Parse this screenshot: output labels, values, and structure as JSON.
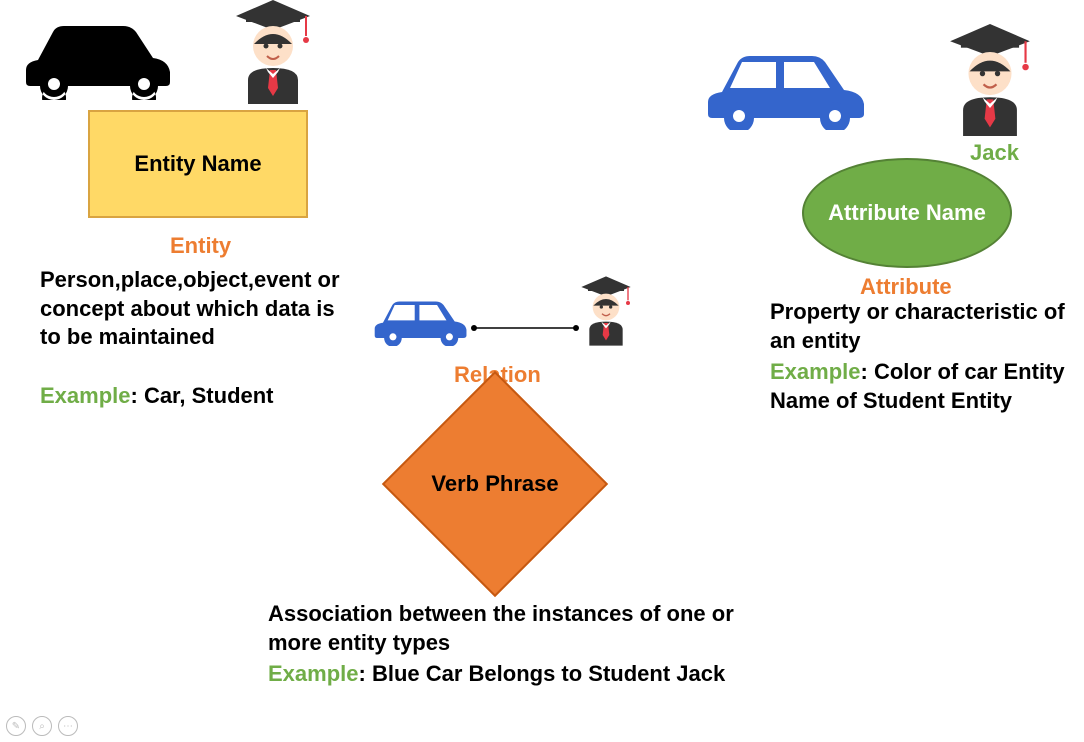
{
  "entity": {
    "shape_label": "Entity Name",
    "title": "Entity",
    "body": "Person,place,object,event or concept about which data is to be maintained",
    "example_label": "Example",
    "example_text": ": Car, Student"
  },
  "attribute": {
    "name_label": "Jack",
    "shape_label": "Attribute Name",
    "title": "Attribute",
    "body": "Property or characteristic of an entity",
    "example_label": "Example",
    "example_text": ": Color of car Entity Name of Student Entity"
  },
  "relation": {
    "title": "Relation",
    "shape_label": "Verb Phrase",
    "body": "Association between the instances of one or more entity types",
    "example_label": "Example",
    "example_text": ": Blue Car Belongs to Student Jack"
  },
  "colors": {
    "accent_orange": "#ed7d31",
    "accent_green": "#70ad47",
    "entity_fill": "#ffd966",
    "car_blue": "#3465cc",
    "car_black": "#000000"
  }
}
